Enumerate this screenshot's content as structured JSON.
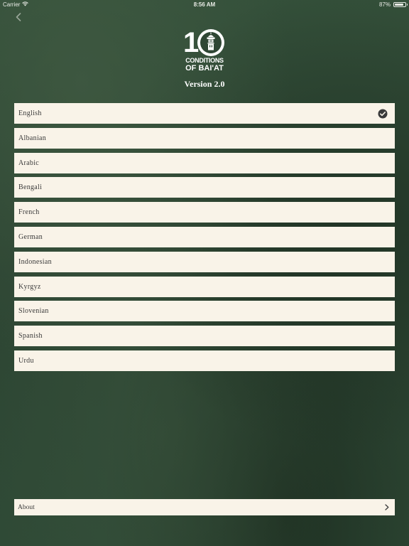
{
  "status_bar": {
    "carrier": "Carrier",
    "time": "8:56 AM",
    "battery_percent": "87%",
    "battery_level": 0.87,
    "wifi_icon": "wifi-icon",
    "battery_icon": "battery-icon"
  },
  "nav": {
    "back_icon": "chevron-left-icon"
  },
  "logo": {
    "line1": "CONDITIONS",
    "line2": "OF BAI'AT",
    "number": "1",
    "icon": "minaret-icon"
  },
  "version": "Version 2.0",
  "languages": [
    {
      "label": "English",
      "selected": true
    },
    {
      "label": "Albanian",
      "selected": false
    },
    {
      "label": "Arabic",
      "selected": false
    },
    {
      "label": "Bengali",
      "selected": false
    },
    {
      "label": "French",
      "selected": false
    },
    {
      "label": "German",
      "selected": false
    },
    {
      "label": "Indonesian",
      "selected": false
    },
    {
      "label": "Kyrgyz",
      "selected": false
    },
    {
      "label": "Slovenian",
      "selected": false
    },
    {
      "label": "Spanish",
      "selected": false
    },
    {
      "label": "Urdu",
      "selected": false
    }
  ],
  "about": {
    "label": "About",
    "icon": "chevron-right-icon"
  },
  "colors": {
    "background": "#2f4634",
    "row_background": "#f9f3e8",
    "text": "#3a3a3a",
    "white": "#ffffff"
  }
}
